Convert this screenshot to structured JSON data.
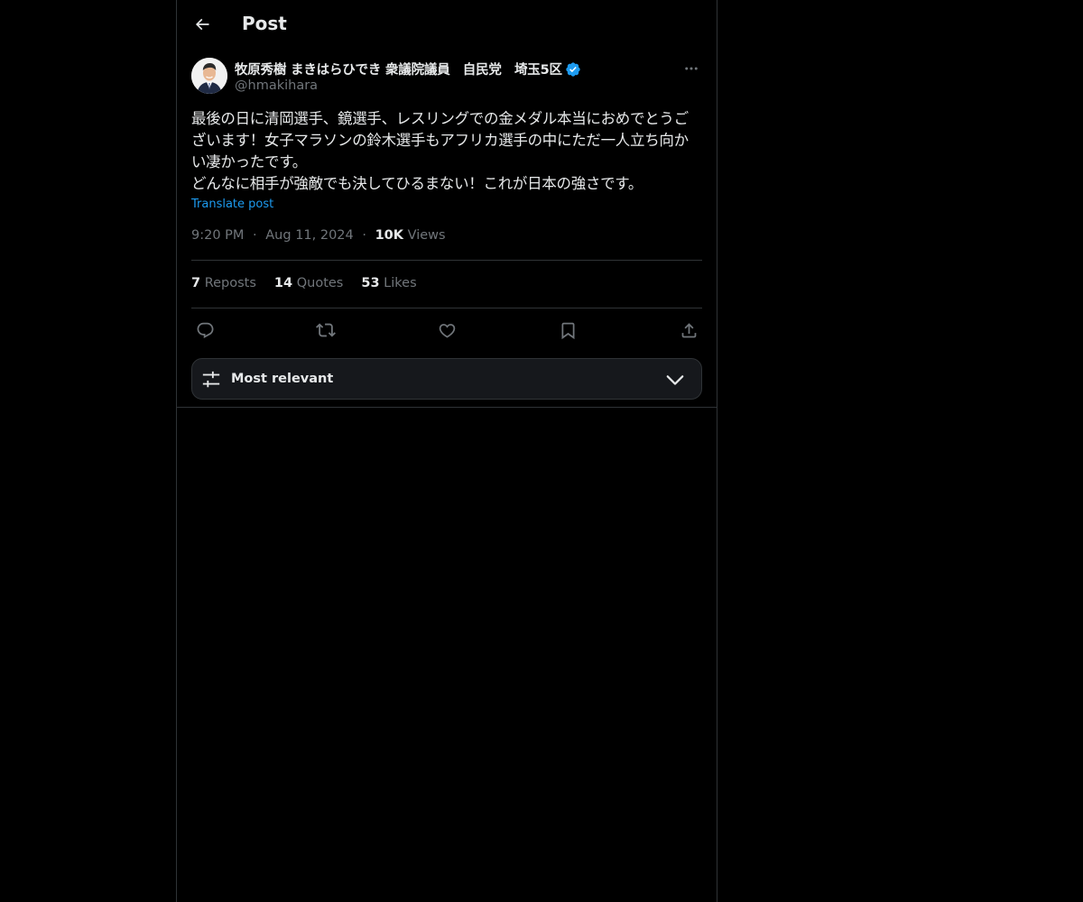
{
  "header": {
    "title": "Post",
    "back_icon": "arrow-left-icon"
  },
  "post": {
    "author_name": "牧原秀樹 まきはらひでき 衆議院議員　自民党　埼玉5区",
    "handle": "@hmakihara",
    "verified": true,
    "text": "最後の日に清岡選手、鏡選手、レスリングでの金メダル本当におめでとうございます！女子マラソンの鈴木選手もアフリカ選手の中にただ一人立ち向かい凄かったです。\nどんなに相手が強敵でも決してひるまない！これが日本の強さです。",
    "translate_label": "Translate post",
    "time": "9:20 PM",
    "date": "Aug 11, 2024",
    "separator": "·",
    "views_count": "10K",
    "views_label": "Views"
  },
  "stats": {
    "reposts_count": "7",
    "reposts_label": "Reposts",
    "quotes_count": "14",
    "quotes_label": "Quotes",
    "likes_count": "53",
    "likes_label": "Likes"
  },
  "sort": {
    "label": "Most relevant"
  },
  "colors": {
    "background": "#000000",
    "text": "#e7e9ea",
    "secondary": "#71767b",
    "accent": "#1d9bf0",
    "border": "#2f3336"
  }
}
